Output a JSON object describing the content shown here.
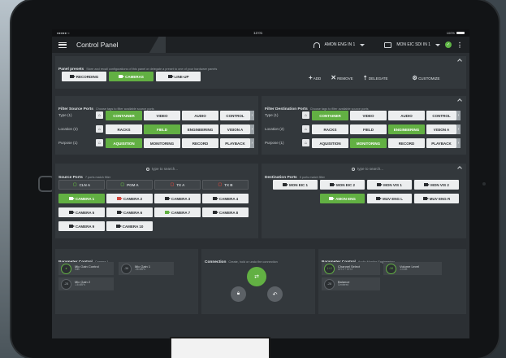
{
  "status": {
    "time": "12:01",
    "battery": "100%"
  },
  "appbar": {
    "title": "Control Panel",
    "audio_monitor": "AMON ENG IN 1",
    "video_monitor": "MON EIC SDI IN 1"
  },
  "panel_presets": {
    "title": "Panel presets",
    "subtitle": "Store and recall configurations of this panel or delegate a preset to one of your hardware panels",
    "presets": [
      "RECORDING",
      "CAMERAS",
      "LINE-UP"
    ],
    "actions": {
      "add": "ADD",
      "remove": "REMOVE",
      "delegate": "DELEGATE",
      "customize": "CUSTOMIZE"
    }
  },
  "filter_source": {
    "title": "Filter Source Ports",
    "subtitle": "Choose tags to filter available source ports",
    "rows": [
      {
        "label": "Type (1)",
        "tags": [
          "CONTAINER",
          "VIDEO",
          "AUDIO",
          "CONTROL"
        ]
      },
      {
        "label": "Location (2)",
        "tags": [
          "RACKS",
          "FIELD",
          "ENGINEERING",
          "VISION A"
        ]
      },
      {
        "label": "Purpose (1)",
        "tags": [
          "AQUISITION",
          "MONITORING",
          "RECORD",
          "PLAYBACK"
        ]
      }
    ]
  },
  "filter_destination": {
    "title": "Filter Destination Ports",
    "subtitle": "Choose tags to filter available source ports",
    "rows": [
      {
        "label": "Type (1)",
        "tags": [
          "CONTAINER",
          "VIDEO",
          "AUDIO",
          "CONTROL"
        ]
      },
      {
        "label": "Location (2)",
        "tags": [
          "RACKS",
          "FIELD",
          "ENGINEERING",
          "VISION A"
        ]
      },
      {
        "label": "Purpose (1)",
        "tags": [
          "AQUISITION",
          "MONITORING",
          "RECORD",
          "PLAYBACK"
        ]
      }
    ]
  },
  "source_ports": {
    "title": "Source Ports",
    "subtitle": "7 ports match filter",
    "search_placeholder": "type to search...",
    "ports": [
      "CLN A",
      "PGM A",
      "TX A",
      "TX B",
      "CAMERA 1",
      "CAMERA 2",
      "CAMERA 3",
      "CAMERA 4",
      "CAMERA 5",
      "CAMERA 6",
      "CAMERA 7",
      "CAMERA 8",
      "CAMERA 9",
      "CAMERA 10"
    ]
  },
  "destination_ports": {
    "title": "Destination Ports",
    "subtitle": "5 ports match filter",
    "search_placeholder": "type to search...",
    "ports": [
      "MON EIC 1",
      "MON EIC 2",
      "MON VIS 1",
      "MON VIS 2",
      "AMON ENG",
      "MUV ENG L",
      "MUV ENG R"
    ]
  },
  "param_left": {
    "title": "Parameter Control",
    "subtitle": "Camera 1",
    "items": [
      {
        "knob": "",
        "label": "Mic Gain Control",
        "value": "0dB"
      },
      {
        "knob": "-36",
        "label": "Mic Gain 1",
        "value": "-36 dBFs"
      },
      {
        "knob": "-28",
        "label": "Mic Gain 2",
        "value": "-16 dBFs"
      }
    ]
  },
  "connection": {
    "title": "Connection",
    "subtitle": "Create, hold or undo the connection"
  },
  "param_right": {
    "title": "Parameter Control",
    "subtitle": "Audio Monitor Engineering",
    "items": [
      {
        "knob": "1+2",
        "label": "Channel Select",
        "value": "CH 1 + CH 2"
      },
      {
        "knob": "-38",
        "label": "Volume Level",
        "value": "-13 dB"
      },
      {
        "knob": "-28",
        "label": "Balance",
        "value": "Centered"
      }
    ]
  },
  "colors": {
    "accent": "#62b043",
    "panel": "#33383c",
    "background": "#2b2f33",
    "source_red": "#d2483f"
  }
}
